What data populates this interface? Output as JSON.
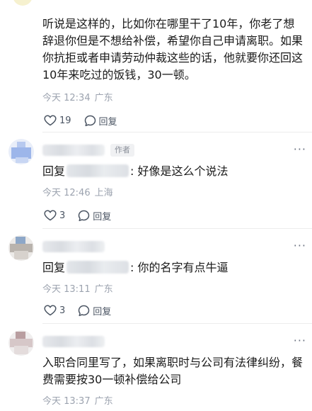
{
  "comments": [
    {
      "text": "听说是这样的，比如你在哪里干了10年，你老了想辞退你但是不想给补偿，希望你自己申请离职。如果你抗拒或者申请劳动仲裁这些的话，他就要你还回这10年来吃过的饭钱，30一顿。",
      "time": "今天 12:34",
      "location": "广东",
      "likes": "19",
      "reply_label": "回复"
    },
    {
      "author_tag": "作者",
      "reply_prefix": "回复",
      "reply_suffix": ": 好像是这么个说法",
      "time": "今天 12:46",
      "location": "上海",
      "likes": "3",
      "reply_label": "回复"
    },
    {
      "reply_prefix": "回复",
      "reply_suffix": ": 你的名字有点牛逼",
      "time": "今天 13:11",
      "location": "广东",
      "likes": "3",
      "reply_label": "回复"
    },
    {
      "text": "入职合同里写了，如果离职时与公司有法律纠纷，餐费需要按30一顿补偿给公司",
      "time": "今天 13:37",
      "location": "广东"
    }
  ],
  "colors": {
    "text": "#1a1a1a",
    "meta": "#9ca3af",
    "action": "#4b5563",
    "divider": "#ececec"
  }
}
